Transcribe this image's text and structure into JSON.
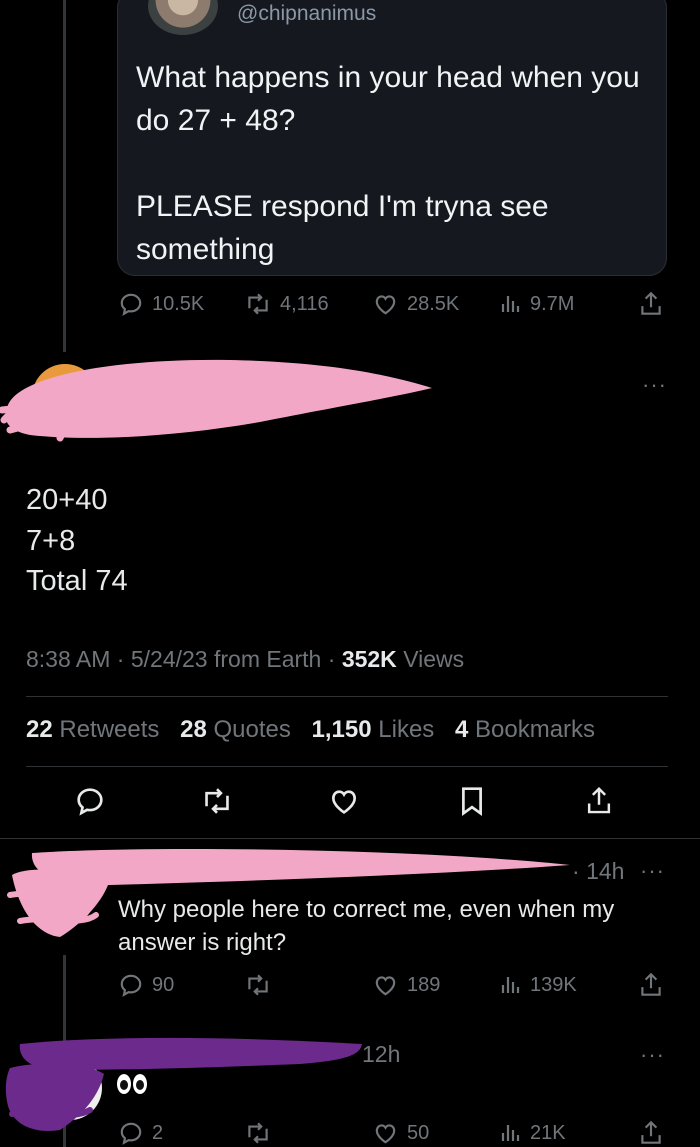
{
  "quoted_tweet": {
    "handle": "@chipnanimus",
    "text": "What happens in your head when you do 27 + 48?\n\nPLEASE respond I'm tryna see something",
    "actions": {
      "replies": "10.5K",
      "retweets": "4,116",
      "likes": "28.5K",
      "views": "9.7M"
    }
  },
  "main_tweet": {
    "body_lines": [
      "20+40",
      "7+8",
      "Total 74"
    ],
    "meta": {
      "time": "8:38 AM",
      "date": "5/24/23",
      "source": "from Earth",
      "views_count": "352K",
      "views_label": "Views"
    },
    "stats": [
      {
        "count": "22",
        "label": "Retweets"
      },
      {
        "count": "28",
        "label": "Quotes"
      },
      {
        "count": "1,150",
        "label": "Likes"
      },
      {
        "count": "4",
        "label": "Bookmarks"
      }
    ]
  },
  "replies": [
    {
      "time": "14h",
      "text": "Why people here to correct me, even when my answer is right?",
      "actions": {
        "replies": "90",
        "likes": "189",
        "views": "139K"
      }
    },
    {
      "time": "12h",
      "actions": {
        "replies": "2",
        "likes": "50",
        "views": "21K"
      }
    }
  ],
  "colors": {
    "background": "#000000",
    "text": "#e7e9ea",
    "muted": "#71767b",
    "redaction_pink": "#f2a7c6",
    "redaction_purple": "#6b2a8c"
  },
  "icons": [
    "reply-icon",
    "retweet-icon",
    "like-icon",
    "views-icon",
    "share-icon",
    "bookmark-icon",
    "more-icon",
    "eyes-emoji"
  ]
}
